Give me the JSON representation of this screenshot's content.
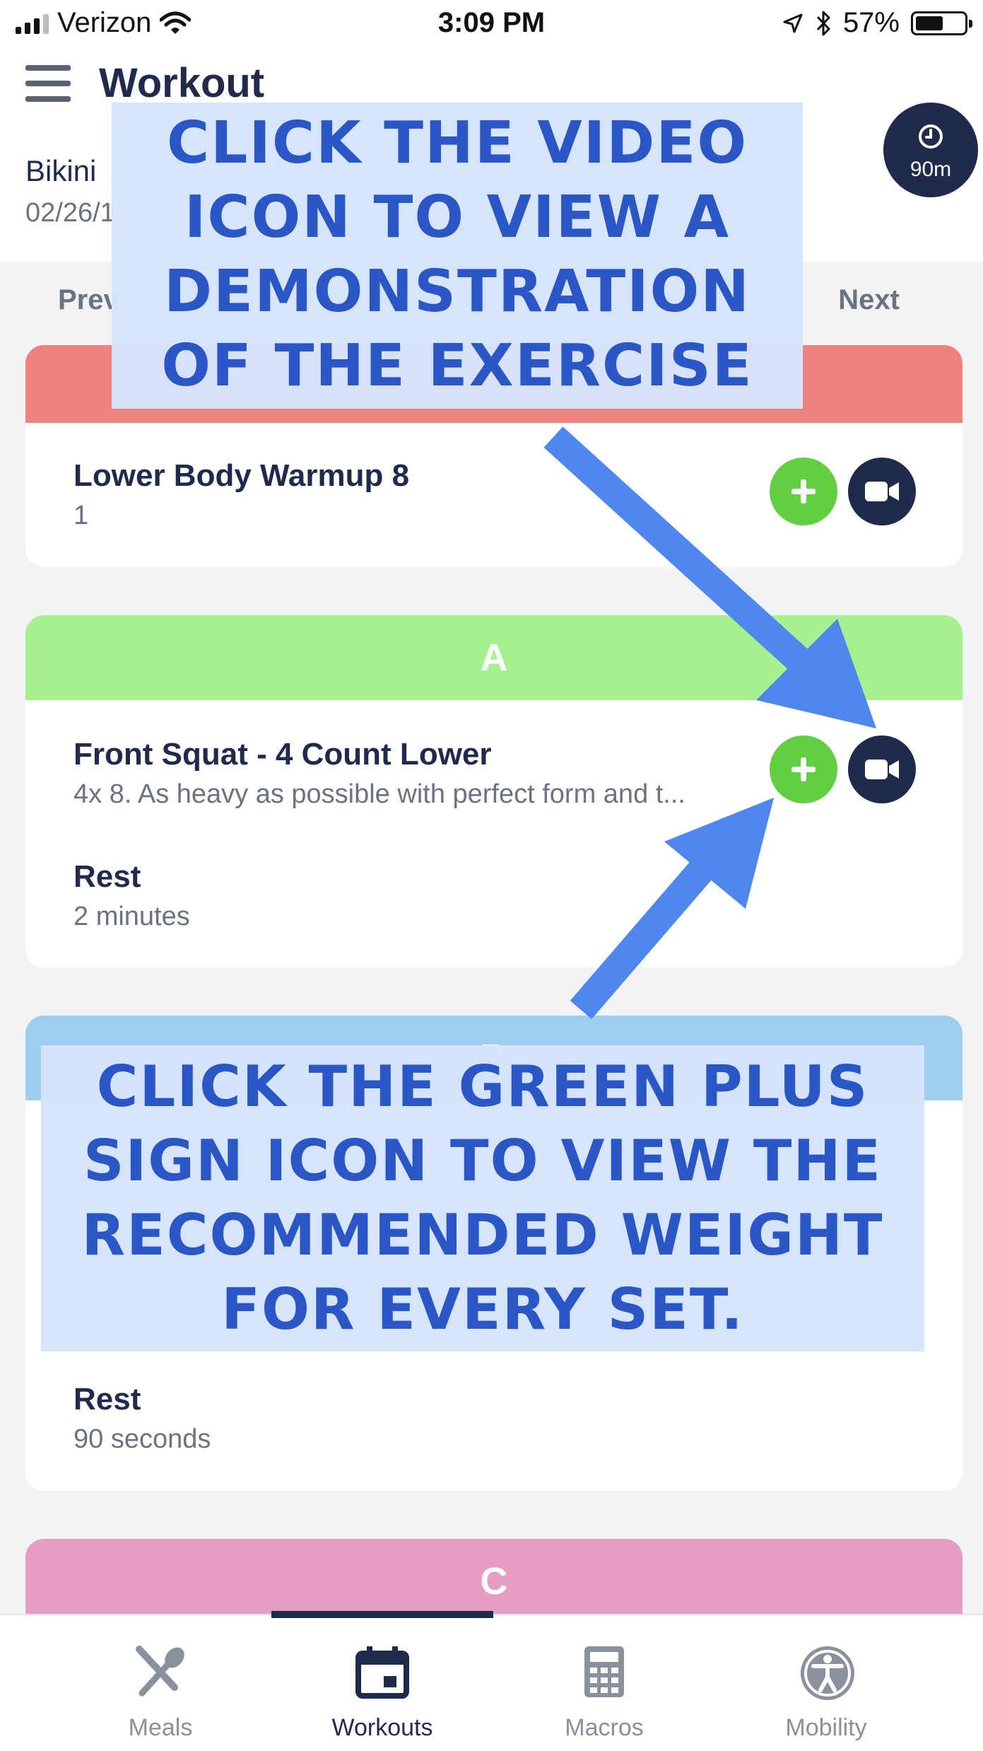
{
  "status_bar": {
    "carrier": "Verizon",
    "time": "3:09 PM",
    "battery": "57%",
    "battery_level": 0.57
  },
  "header": {
    "title": "Workout",
    "program": "Bikini",
    "date": "02/26/1"
  },
  "timer": {
    "label": "90m"
  },
  "day_nav": {
    "prev": "Prev",
    "next": "Next"
  },
  "cards": [
    {
      "header": "",
      "color": "#ee827f",
      "exercises": [
        {
          "name": "Lower Body Warmup 8",
          "detail": "1"
        }
      ]
    },
    {
      "header": "A",
      "color": "#a6f092",
      "exercises": [
        {
          "name": "Front Squat - 4 Count Lower",
          "detail": "4x 8. As heavy as possible with perfect form and t..."
        }
      ],
      "rest": {
        "label": "Rest",
        "value": "2 minutes"
      }
    },
    {
      "header": "B",
      "color": "#9fcdee",
      "rest": {
        "label": "Rest",
        "value": "90 seconds"
      }
    },
    {
      "header": "C",
      "color": "#e79cc4"
    }
  ],
  "tabs": [
    {
      "label": "Meals",
      "icon": "fork-spoon-icon"
    },
    {
      "label": "Workouts",
      "icon": "calendar-icon",
      "active": true
    },
    {
      "label": "Macros",
      "icon": "calculator-icon"
    },
    {
      "label": "Mobility",
      "icon": "accessibility-icon"
    }
  ],
  "callouts": [
    {
      "text": "Click the video icon to view a demonstration of the exercise"
    },
    {
      "text": "Click the green plus sign icon to view the recommended weight for every set."
    }
  ],
  "colors": {
    "navy": "#1f2a4d",
    "green": "#62cf42",
    "callout_text": "#2a56c6",
    "arrow": "#4f87ee"
  }
}
